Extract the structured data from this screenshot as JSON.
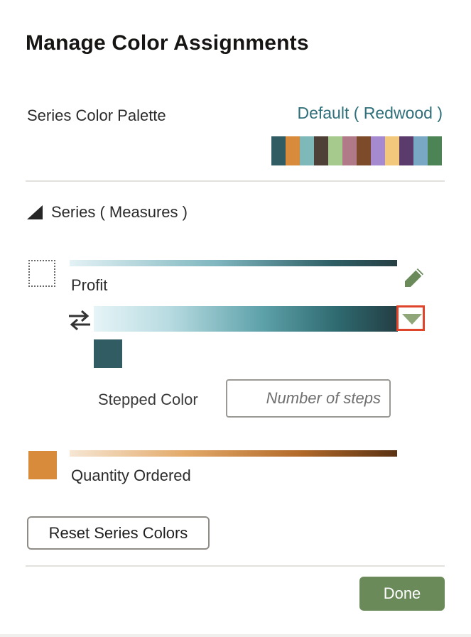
{
  "dialog": {
    "title": "Manage Color Assignments"
  },
  "palette": {
    "label": "Series Color Palette",
    "selected": "Default ( Redwood )",
    "swatch_colors": [
      "#315c63",
      "#d88b3a",
      "#7fb8b8",
      "#4e3f37",
      "#a6c98e",
      "#b07a88",
      "#7d4a2a",
      "#a58ad0",
      "#f2c97c",
      "#5a3b6c",
      "#79a8c4",
      "#4d8456"
    ]
  },
  "series_section": {
    "heading": "Series ( Measures )",
    "items": [
      {
        "label": "Profit",
        "gradient": [
          "#e3f2f5",
          "#7fb6bf",
          "#2f5f66",
          "#263f44"
        ],
        "selected_color": "#315c63",
        "stepped_label": "Stepped Color",
        "steps_placeholder": "Number of steps",
        "steps_value": ""
      },
      {
        "label": "Quantity Ordered",
        "swatch_color": "#d88b3a",
        "gradient": [
          "#f6e6d3",
          "#e3aa6a",
          "#b36a2a",
          "#5a3212"
        ]
      }
    ]
  },
  "buttons": {
    "reset": "Reset Series Colors",
    "done": "Done"
  },
  "colors": {
    "accent_link": "#2f6f7a",
    "done_bg": "#6b8a5a",
    "highlight": "#e0442a"
  }
}
